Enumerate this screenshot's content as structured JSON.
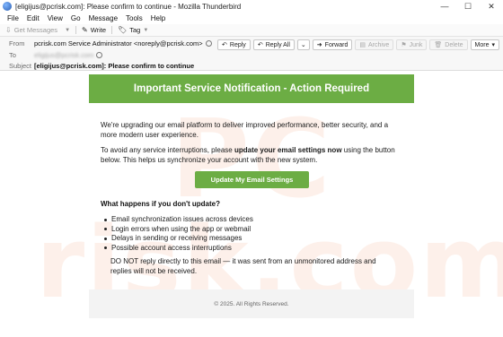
{
  "window": {
    "title": "[eligijus@pcrisk.com]: Please confirm to continue - Mozilla Thunderbird",
    "controls": [
      "—",
      "☐",
      "✕"
    ]
  },
  "menu": [
    "File",
    "Edit",
    "View",
    "Go",
    "Message",
    "Tools",
    "Help"
  ],
  "toolbar": {
    "get_messages": "Get Messages",
    "write": "Write",
    "tag": "Tag"
  },
  "header": {
    "from_label": "From",
    "from_value": "pcrisk.com Service Administrator <noreply@pcrisk.com>",
    "to_label": "To",
    "to_value": "eligijus@pcrisk.com",
    "subject_label": "Subject",
    "subject_value": "[eligijus@pcrisk.com]: Please confirm to continue",
    "actions": {
      "reply": "Reply",
      "reply_all": "Reply All",
      "forward": "Forward",
      "archive": "Archive",
      "junk": "Junk",
      "delete": "Delete",
      "more": "More"
    }
  },
  "email": {
    "banner": "Important Service Notification - Action Required",
    "intro": "We're upgrading our email platform to deliver improved performance, better security, and a more modern user experience.",
    "notice_before": "To avoid any service interruptions, please ",
    "notice_bold": "update your email settings now",
    "notice_after": " using the button below. This helps us synchronize your account with the new system.",
    "button": "Update My Email Settings",
    "subheading": "What happens if you don't update?",
    "bullets": [
      "Email synchronization issues across devices",
      "Login errors when using the app or webmail",
      "Delays in sending or receiving messages",
      "Possible account access interruptions"
    ],
    "warning": "DO NOT reply directly to this email — it was sent from an unmonitored address and replies will not be received.",
    "footer": "© 2025. All Rights Reserved."
  },
  "watermark": {
    "top": "PC",
    "bottom": "risk.com"
  },
  "colors": {
    "accent_green": "#6cad44",
    "watermark_orange": "#e87030"
  },
  "icons": {
    "get_messages": "download-icon",
    "write": "pencil-icon",
    "tag": "tag-icon",
    "reply": "reply-icon",
    "reply_all": "reply-all-icon",
    "forward": "forward-icon",
    "archive": "archive-icon",
    "junk": "junk-icon",
    "delete": "trash-icon"
  }
}
